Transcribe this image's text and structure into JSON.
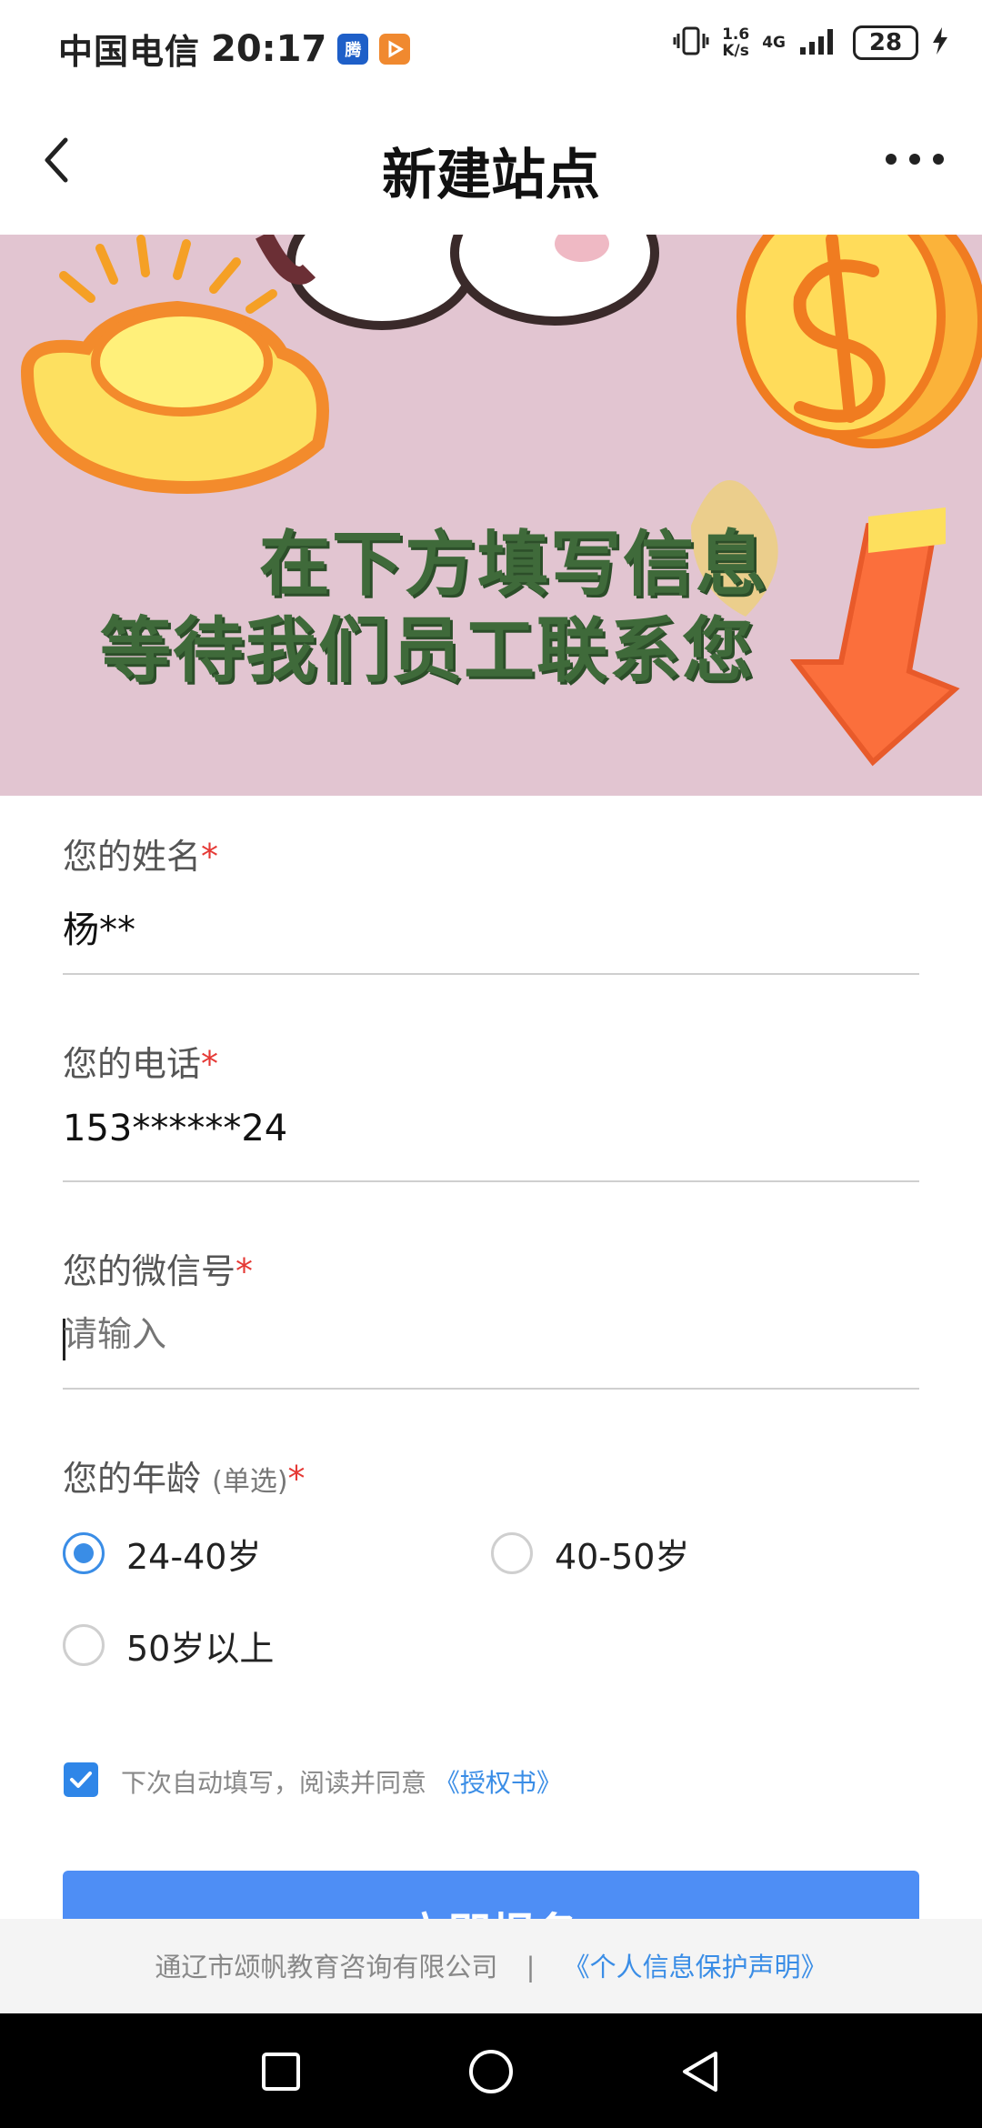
{
  "status_bar": {
    "carrier": "中国电信",
    "time": "20:17",
    "app_icon_1": "腾",
    "speed_value": "1.6",
    "speed_unit": "K/s",
    "network": "4G",
    "battery": "28"
  },
  "nav": {
    "title": "新建站点",
    "back_icon": "chevron-left-icon",
    "more_icon": "more-horizontal-icon"
  },
  "banner": {
    "line1": "在下方填写信息",
    "line2": "等待我们员工联系您"
  },
  "form": {
    "name": {
      "label": "您的姓名",
      "required": "*",
      "value": "杨**"
    },
    "phone": {
      "label": "您的电话",
      "required": "*",
      "value": "153******24"
    },
    "wechat": {
      "label": "您的微信号",
      "required": "*",
      "placeholder": "请输入"
    },
    "age": {
      "label": "您的年龄",
      "hint": "(单选)",
      "required": "*",
      "options": [
        "24-40岁",
        "40-50岁",
        "50岁以上"
      ],
      "selected": "24-40岁"
    },
    "agree": {
      "checked": true,
      "text": "下次自动填写，阅读并同意",
      "link": "《授权书》"
    },
    "submit_label": "立即报名"
  },
  "footer": {
    "company": "通辽市颂帆教育咨询有限公司",
    "separator": "|",
    "link": "《个人信息保护声明》"
  },
  "colors": {
    "accent": "#3a8de6",
    "button": "#4e8ef5",
    "required": "#e53935",
    "banner_bg": "#e2c5d1",
    "banner_text": "#3f6a3a"
  }
}
